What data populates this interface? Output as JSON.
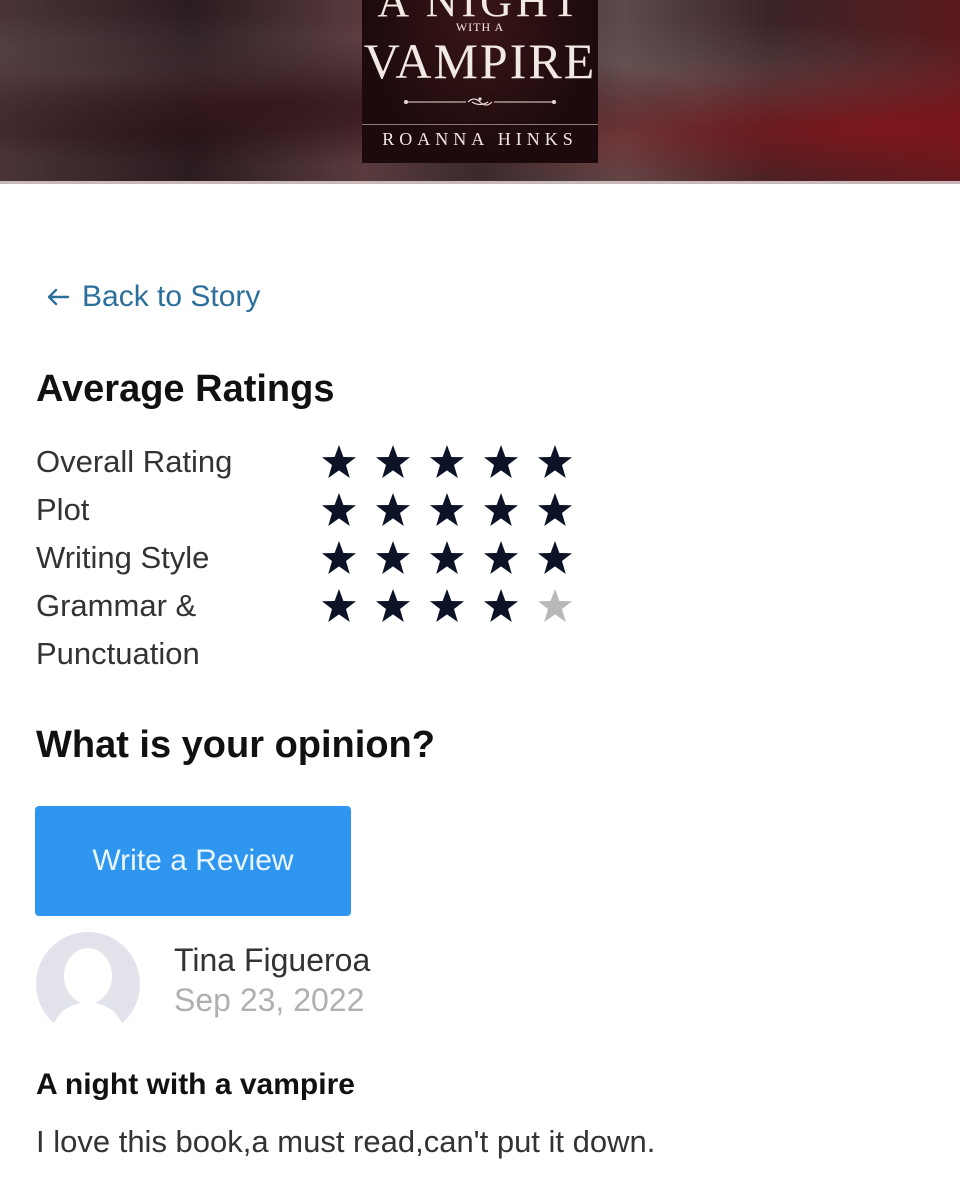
{
  "book": {
    "title_line1": "A NIGHT",
    "title_line2": "WITH A",
    "title_line3": "VAMPIRE",
    "author": "ROANNA HINKS"
  },
  "nav": {
    "back_label": "Back to Story"
  },
  "ratings": {
    "heading": "Average Ratings",
    "items": [
      {
        "label": "Overall Rating",
        "stars": 5,
        "max": 5
      },
      {
        "label": "Plot",
        "stars": 5,
        "max": 5
      },
      {
        "label": "Writing Style",
        "stars": 5,
        "max": 5
      },
      {
        "label": "Grammar & Punctuation",
        "stars": 4,
        "max": 5
      }
    ],
    "colors": {
      "filled": "#0d1326",
      "empty": "#b8b8b8"
    }
  },
  "opinion": {
    "heading": "What is your opinion?",
    "button_label": "Write a Review"
  },
  "review": {
    "reviewer": "Tina Figueroa",
    "date": "Sep 23, 2022",
    "title": "A night with a vampire",
    "body": "I love this book,a must read,can't put it down."
  },
  "colors": {
    "accent": "#2f96ef",
    "link": "#2d6f9b"
  }
}
